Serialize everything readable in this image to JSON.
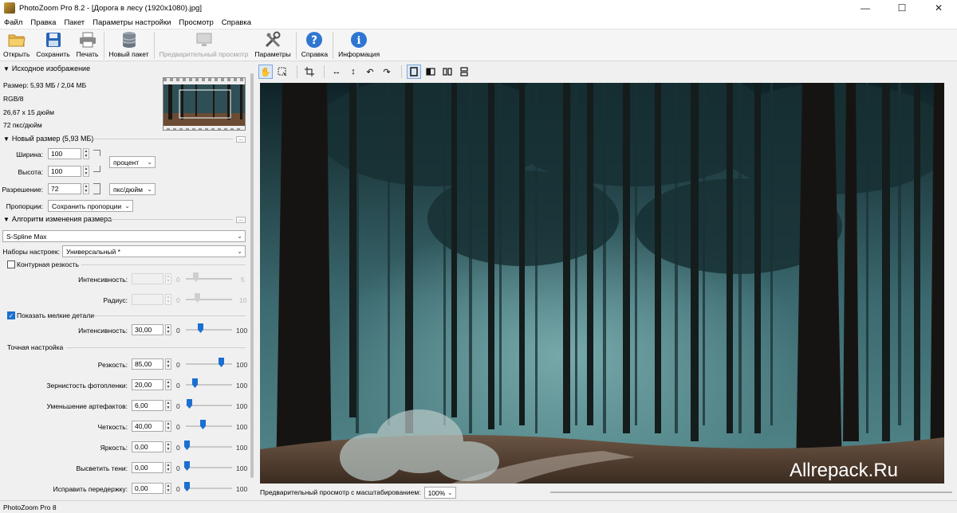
{
  "window": {
    "title": "PhotoZoom Pro 8.2 - [Дорога в лесу (1920x1080).jpg]",
    "minimize": "—",
    "maximize": "☐",
    "close": "✕"
  },
  "menu": [
    "Файл",
    "Правка",
    "Пакет",
    "Параметры настройки",
    "Просмотр",
    "Справка"
  ],
  "toolbar": {
    "open": "Открыть",
    "save": "Сохранить",
    "print": "Печать",
    "new_batch": "Новый пакет",
    "preview": "Предварительный просмотр",
    "params": "Параметры",
    "help": "Справка",
    "info": "Информация"
  },
  "source": {
    "header": "Исходное изображение",
    "size": "Размер: 5,93 МБ / 2,04 МБ",
    "mode": "RGB/8",
    "dims": "26,67 x 15 дюйм",
    "res": "72 пкс/дюйм"
  },
  "new_size": {
    "header": "Новый размер (5,93 МБ)",
    "width_label": "Ширина:",
    "width_value": "100",
    "height_label": "Высота:",
    "height_value": "100",
    "unit": "процент",
    "res_label": "Разрешение:",
    "res_value": "72",
    "res_unit": "пкс/дюйм",
    "prop_label": "Пропорции:",
    "prop_value": "Сохранить пропорции",
    "dots": "..."
  },
  "algo": {
    "header": "Алгоритм изменения размера",
    "method": "S-Spline Max",
    "presets_label": "Наборы настроек:",
    "presets_value": "Универсальный *",
    "dots": "..."
  },
  "sharpness": {
    "checkbox": "Контурная резкость",
    "intensity_label": "Интенсивность:",
    "intensity_min": "0",
    "intensity_max": "5",
    "radius_label": "Радиус:",
    "radius_min": "0",
    "radius_max": "10"
  },
  "details": {
    "checkbox": "Показать мелкие детали",
    "intensity_label": "Интенсивность:",
    "intensity_value": "30,00",
    "min": "0",
    "max": "100"
  },
  "fine": {
    "header": "Точная настройка",
    "rows": [
      {
        "label": "Резкость:",
        "value": "85,00",
        "min": "0",
        "max": "100",
        "level": 85
      },
      {
        "label": "Зернистость фотопленки:",
        "value": "20,00",
        "min": "0",
        "max": "100",
        "level": 20
      },
      {
        "label": "Уменьшение артефактов:",
        "value": "6,00",
        "min": "0",
        "max": "100",
        "level": 6
      },
      {
        "label": "Четкость:",
        "value": "40,00",
        "min": "0",
        "max": "100",
        "level": 40
      },
      {
        "label": "Яркость:",
        "value": "0,00",
        "min": "0",
        "max": "100",
        "level": 0
      },
      {
        "label": "Высветить тени:",
        "value": "0,00",
        "min": "0",
        "max": "100",
        "level": 0
      },
      {
        "label": "Исправить передержку:",
        "value": "0,00",
        "min": "0",
        "max": "100",
        "level": 0
      }
    ]
  },
  "preview": {
    "watermark": "Allrepack.Ru",
    "zoom_label": "Предварительный просмотр с масштабированием:",
    "zoom_value": "100%"
  },
  "status": "PhotoZoom Pro 8"
}
